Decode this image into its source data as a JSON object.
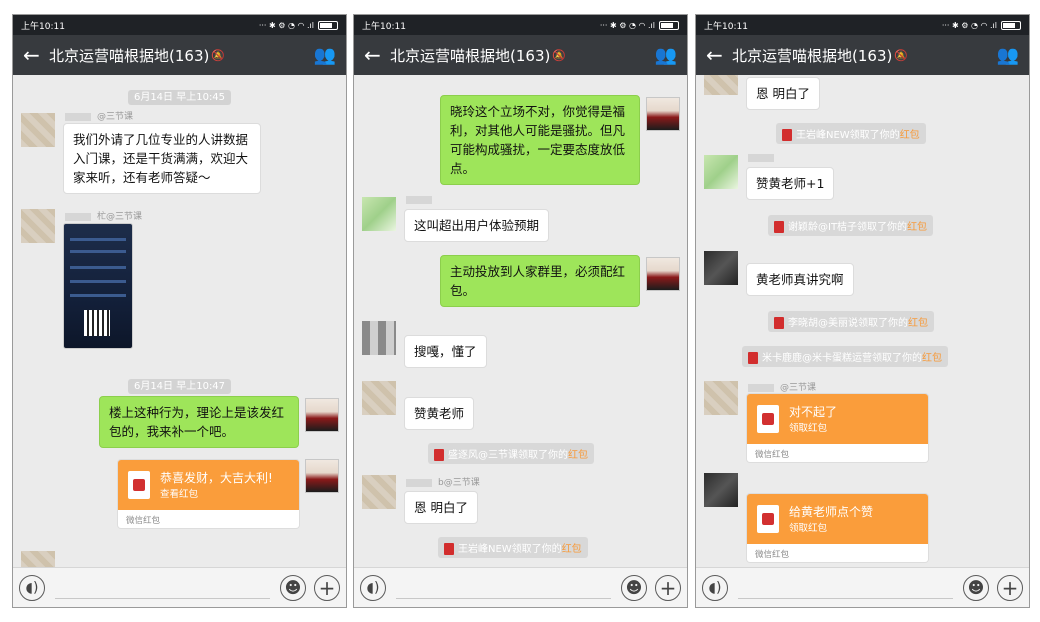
{
  "phones": [
    {
      "status_time": "上午10:11",
      "title": "北京运营喵根据地(163)",
      "ts1": "6月14日 早上10:45",
      "sender1": "@三节课",
      "msg1": "我们外请了几位专业的人讲数据入门课，还是干货满满，欢迎大家来听，还有老师答疑～",
      "sender2": "杧@三节课",
      "ts2": "6月14日 早上10:47",
      "msg2": "楼上这种行为，理论上是该发红包的，我来补一个吧。",
      "redpacket": {
        "title": "恭喜发财，大吉大利!",
        "action": "查看红包",
        "footer": "微信红包"
      }
    },
    {
      "status_time": "上午10:11",
      "title": "北京运营喵根据地(163)",
      "msg1": "晓玲这个立场不对，你觉得是福利，对其他人可能是骚扰。但凡可能构成骚扰，一定要态度放低点。",
      "msg2": "这叫超出用户体验预期",
      "msg3": "主动投放到人家群里，必须配红包。",
      "msg4": "搜嘎，懂了",
      "msg5": "赞黄老师",
      "notice1_pre": "盛逐风@三节课领取了你的",
      "notice1_hb": "红包",
      "sender6": "b@三节课",
      "msg6": "恩 明白了",
      "notice2_pre": "王岩峰NEW领取了你的",
      "notice2_hb": "红包"
    },
    {
      "status_time": "上午10:11",
      "title": "北京运营喵根据地(163)",
      "msg1": "恩 明白了",
      "notice1_pre": "王岩峰NEW领取了你的",
      "notice1_hb": "红包",
      "msg2": "赞黄老师+1",
      "notice2_pre": "谢颖龄@IT桔子领取了你的",
      "notice2_hb": "红包",
      "msg3": "黄老师真讲究啊",
      "notice3_pre": "李晓胡@美丽说领取了你的",
      "notice3_hb": "红包",
      "notice4_pre": "米卡鹿鹿@米卡蛋糕运营领取了你的",
      "notice4_hb": "红包",
      "sender5": "@三节课",
      "rp1": {
        "title": "对不起了",
        "action": "领取红包",
        "footer": "微信红包"
      },
      "rp2": {
        "title": "给黄老师点个赞",
        "action": "领取红包",
        "footer": "微信红包"
      }
    }
  ],
  "icons": {
    "back": "back-arrow-icon",
    "mute": "mute-bell-icon",
    "group": "group-members-icon",
    "voice": "voice-icon",
    "emoji": "emoji-icon",
    "plus": "plus-icon"
  },
  "colors": {
    "titlebar": "#373a3e",
    "outgoing": "#9ee55a",
    "redpacket": "#fa9d3b",
    "chat_bg": "#ebebeb"
  }
}
